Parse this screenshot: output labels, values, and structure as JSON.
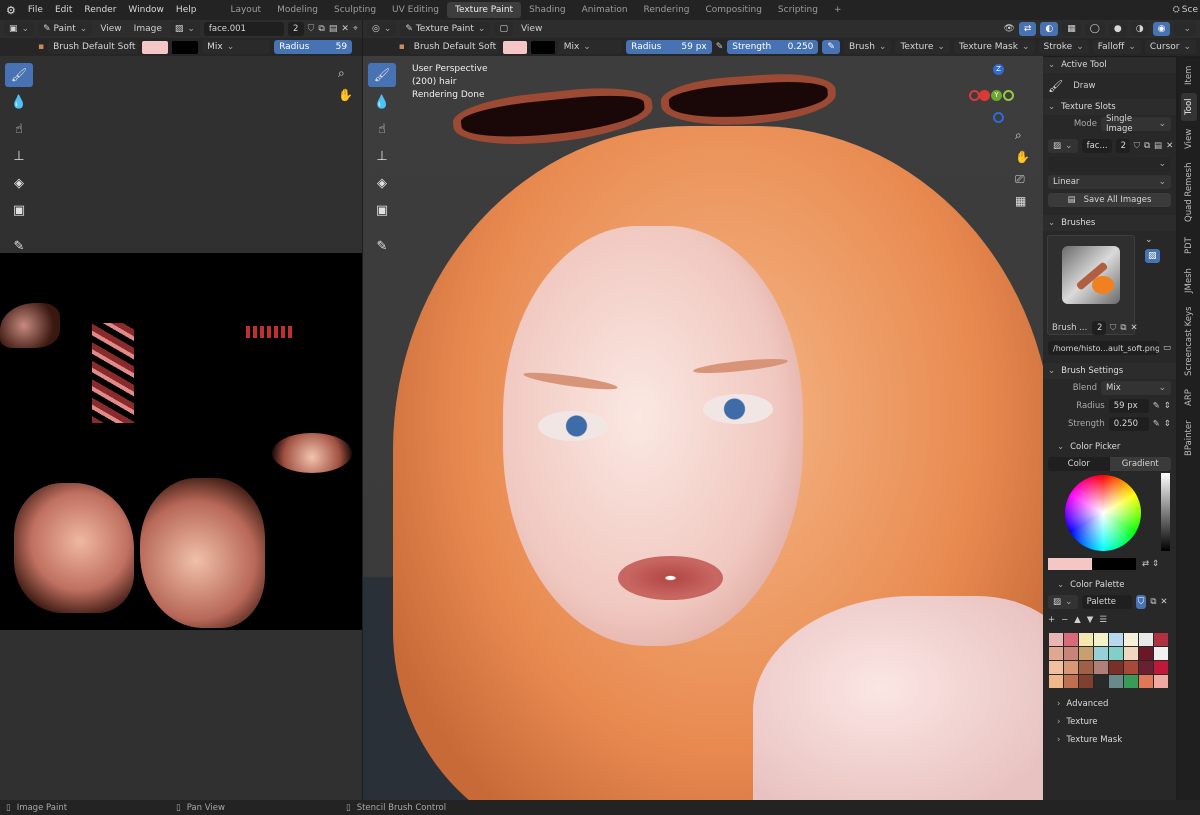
{
  "topbar": {
    "menus": [
      "File",
      "Edit",
      "Render",
      "Window",
      "Help"
    ],
    "workspaces": [
      "Layout",
      "Modeling",
      "Sculpting",
      "UV Editing",
      "Texture Paint",
      "Shading",
      "Animation",
      "Rendering",
      "Compositing",
      "Scripting"
    ],
    "active_workspace": "Texture Paint",
    "plus": "+",
    "scene_label": "Sce"
  },
  "image_editor": {
    "mode": "Paint",
    "menus": [
      "View",
      "Image"
    ],
    "image_name": "face.001",
    "user_count": "2",
    "brush_name": "Brush Default Soft",
    "blend": "Mix",
    "radius_label": "Radius",
    "radius_value": "59",
    "tools": [
      "Draw",
      "Soften",
      "Smear",
      "Clone",
      "Fill",
      "Mask",
      "Annotate"
    ]
  },
  "viewport": {
    "mode": "Texture Paint",
    "menu_view": "View",
    "brush_name": "Brush Default Soft",
    "blend": "Mix",
    "radius_label": "Radius",
    "radius_value": "59 px",
    "strength_label": "Strength",
    "strength_value": "0.250",
    "menus": [
      "Brush",
      "Texture",
      "Texture Mask",
      "Stroke",
      "Falloff",
      "Cursor"
    ],
    "overlay_lines": [
      "User Perspective",
      "(200) hair",
      "Rendering Done"
    ],
    "gizmo_z": "Z",
    "gizmo_y": "Y"
  },
  "npanel": {
    "active_tool_header": "Active Tool",
    "active_tool": "Draw",
    "texture_slots_header": "Texture Slots",
    "mode_label": "Mode",
    "mode_value": "Single Image",
    "slot_name": "fac...",
    "slot_users": "2",
    "interpolation": "Linear",
    "save_all": "Save All Images",
    "brushes_header": "Brushes",
    "brush_short": "Brush ...",
    "brush_users": "2",
    "brush_path": "/home/histo...ault_soft.png",
    "brush_settings_header": "Brush Settings",
    "blend_label": "Blend",
    "blend_value": "Mix",
    "radius_label": "Radius",
    "radius_value": "59 px",
    "strength_label": "Strength",
    "strength_value": "0.250",
    "color_picker_header": "Color Picker",
    "color_tab": "Color",
    "gradient_tab": "Gradient",
    "color_palette_header": "Color Palette",
    "palette_name": "Palette",
    "palette_colors": [
      "#e8b4b4",
      "#d86a7a",
      "#f6e6b0",
      "#f4f2c8",
      "#b8d8ee",
      "#f6f0d8",
      "#e8e8e8",
      "#b03040",
      "#e0a890",
      "#c88478",
      "#c8a070",
      "#98d0d8",
      "#80d0c8",
      "#f0d8c0",
      "#6a1828",
      "#f0f0f0",
      "#f0c0a0",
      "#d89878",
      "#a06048",
      "#b08078",
      "#7a3028",
      "#a84838",
      "#6a2030",
      "#c01838",
      "#f0b888",
      "#c07050",
      "#804030",
      "#2a2a2a",
      "#6a8a88",
      "#3a9a58",
      "#e07858",
      "#f0a8a0"
    ],
    "advanced": "Advanced",
    "texture": "Texture",
    "texture_mask": "Texture Mask"
  },
  "side_tabs": [
    "Item",
    "Tool",
    "View",
    "Quad Remesh",
    "PDT",
    "JMesh",
    "Screencast Keys",
    "ARP",
    "BPainter"
  ],
  "active_side_tab": "Tool",
  "statusbar": [
    "Image Paint",
    "Pan View",
    "Stencil Brush Control"
  ],
  "colors": {
    "accent": "#4772b3",
    "brush_color": "#f5c6c6",
    "secondary_color": "#000000"
  }
}
